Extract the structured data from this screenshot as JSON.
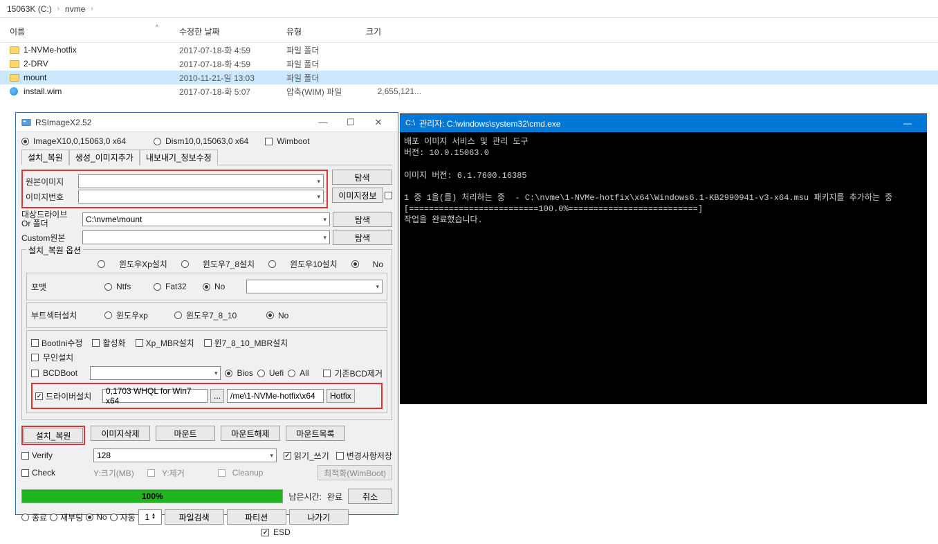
{
  "explorer": {
    "breadcrumb": [
      "15063K (C:)",
      "nvme"
    ],
    "headers": {
      "name": "이름",
      "date": "수정한 날짜",
      "type": "유형",
      "size": "크기"
    },
    "rows": [
      {
        "icon": "folder",
        "name": "1-NVMe-hotfix",
        "date": "2017-07-18-화 4:59",
        "type": "파일 폴더",
        "size": "",
        "sel": false
      },
      {
        "icon": "folder",
        "name": "2-DRV",
        "date": "2017-07-18-화 4:59",
        "type": "파일 폴더",
        "size": "",
        "sel": false
      },
      {
        "icon": "folder",
        "name": "mount",
        "date": "2010-11-21-일 13:03",
        "type": "파일 폴더",
        "size": "",
        "sel": true
      },
      {
        "icon": "wim",
        "name": "install.wim",
        "date": "2017-07-18-화 5:07",
        "type": "압축(WIM) 파일",
        "size": "2,655,121...",
        "sel": false
      }
    ]
  },
  "rsx": {
    "title": "RSImageX2.52",
    "top_radio": {
      "imagex": "ImageX10,0,15063,0 x64",
      "dism": "Dism10,0,15063,0 x64",
      "wimboot": "Wimboot"
    },
    "tabs": [
      "설치_복원",
      "생성_이미지추가",
      "내보내기_정보수정"
    ],
    "lbl_src": "원본이미지",
    "lbl_num": "이미지번호",
    "btn_browse": "탐색",
    "btn_info": "이미지정보",
    "lbl_target": "대상드라이브\nOr 폴더",
    "target_combo": "C:\\nvme\\mount",
    "lbl_custom": "Custom원본",
    "group_title": "설치_복원 옵션",
    "os_opts": [
      "윈도우Xp설치",
      "윈도우7_8설치",
      "윈도우10설치",
      "No"
    ],
    "lbl_format": "포맷",
    "fmt_opts": [
      "Ntfs",
      "Fat32",
      "No"
    ],
    "lbl_boot": "부트섹터설치",
    "boot_opts": [
      "윈도우xp",
      "윈도우7_8_10",
      "No"
    ],
    "chk_bootini": "BootIni수정",
    "chk_active": "활성화",
    "chk_xpmbr": "Xp_MBR설치",
    "chk_win7mbr": "윈7_8_10_MBR설치",
    "chk_unattend": "무인설치",
    "chk_bcdboot": "BCDBoot",
    "bcd_opts": [
      "Bios",
      "Uefi",
      "All"
    ],
    "chk_bcdremove": "기존BCD제거",
    "chk_driver": "드라이버설치",
    "driver_txt": "0,1703 WHQL for Win7 x64",
    "hotfix_path": "/me\\1-NVMe-hotfix\\x64",
    "btn_hotfix": "Hotfix",
    "btn_install": "설치_복원",
    "btn_delimage": "이미지삭제",
    "btn_mount": "마운트",
    "btn_unmount": "마운트해제",
    "btn_mountlist": "마운트목록",
    "chk_verify": "Verify",
    "q_val": "128",
    "chk_rw": "읽기_쓰기",
    "chk_save": "변경사항저장",
    "chk_check": "Check",
    "lbl_sizemb": "Y:크기(MB)",
    "chk_yremove": "Y:제거",
    "chk_cleanup": "Cleanup",
    "btn_optimize": "최적화(WimBoot)",
    "progress": "100%",
    "lbl_elapsed": "남은시간:",
    "val_elapsed": "완료",
    "btn_cancel": "취소",
    "end_opts": [
      "종료",
      "재부팅",
      "No",
      "자동"
    ],
    "spin_val": "1",
    "btn_filesearch": "파일검색",
    "btn_partition": "파티션",
    "btn_exit": "나가기",
    "chk_esd": "ESD"
  },
  "cmd": {
    "title": "관리자: C:\\windows\\system32\\cmd.exe",
    "lines": [
      "배포 이미지 서비스 및 관리 도구",
      "버전: 10.0.15063.0",
      "",
      "이미지 버전: 6.1.7600.16385",
      "",
      "1 중 1을(를) 처리하는 중  - C:\\nvme\\1-NVMe-hotfix\\x64\\Windows6.1-KB2990941-v3-x64.msu 패키지를 추가하는 중",
      "[==========================100.0%==========================]",
      "작업을 완료했습니다."
    ]
  }
}
